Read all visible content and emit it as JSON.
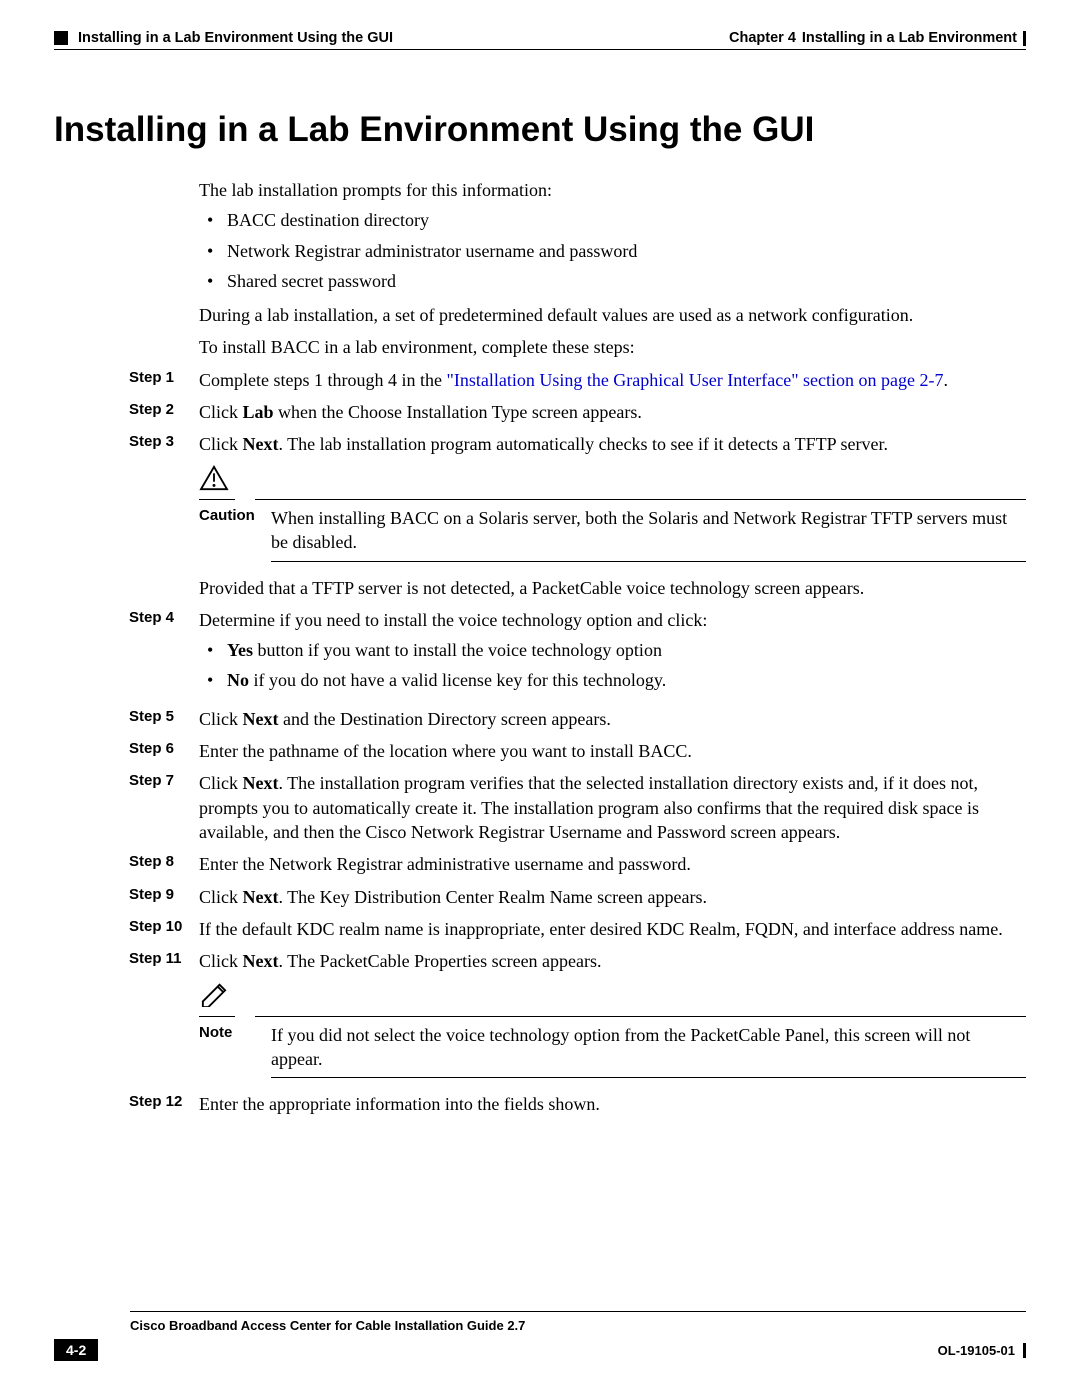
{
  "header": {
    "left": "Installing in a Lab Environment Using the GUI",
    "right_prefix": "Chapter 4",
    "right_title": "Installing in a Lab Environment"
  },
  "title": "Installing in a Lab Environment Using the GUI",
  "intro": "The lab installation prompts for this information:",
  "intro_bullets": [
    "BACC destination directory",
    "Network Registrar administrator username and password",
    "Shared secret password"
  ],
  "para1": "During a lab installation, a set of predetermined default values are used as a network configuration.",
  "para2": "To install BACC in a lab environment, complete these steps:",
  "steps": {
    "s1": {
      "label": "Step 1",
      "prefix": "Complete steps 1 through 4 in the ",
      "link": "\"Installation Using the Graphical User Interface\" section on page 2-7",
      "suffix": "."
    },
    "s2": {
      "label": "Step 2",
      "a": "Click ",
      "b": "Lab",
      "c": " when the Choose Installation Type screen appears."
    },
    "s3": {
      "label": "Step 3",
      "a": "Click ",
      "b": "Next",
      "c": ". The lab installation program automatically checks to see if it detects a TFTP server."
    },
    "caution": {
      "label": "Caution",
      "text": "When installing BACC on a Solaris server, both the Solaris and Network Registrar TFTP servers must be disabled."
    },
    "after_caution": "Provided that a TFTP server is not detected, a PacketCable voice technology screen appears.",
    "s4": {
      "label": "Step 4",
      "text": "Determine if you need to install the voice technology option and click:",
      "b1a": "Yes",
      "b1b": " button if you want to install the voice technology option",
      "b2a": "No",
      "b2b": " if you do not have a valid license key for this technology."
    },
    "s5": {
      "label": "Step 5",
      "a": "Click ",
      "b": "Next",
      "c": " and the Destination Directory screen appears."
    },
    "s6": {
      "label": "Step 6",
      "text": "Enter the pathname of the location where you want to install BACC."
    },
    "s7": {
      "label": "Step 7",
      "a": "Click ",
      "b": "Next",
      "c": ". The installation program verifies that the selected installation directory exists and, if it does not, prompts you to automatically create it. The installation program also confirms that the required disk space is available, and then the Cisco Network Registrar Username and Password screen appears."
    },
    "s8": {
      "label": "Step 8",
      "text": "Enter the Network Registrar administrative username and password."
    },
    "s9": {
      "label": "Step 9",
      "a": "Click ",
      "b": "Next",
      "c": ". The Key Distribution Center Realm Name screen appears."
    },
    "s10": {
      "label": "Step 10",
      "text": "If the default KDC realm name is inappropriate, enter desired KDC Realm, FQDN, and interface address name."
    },
    "s11": {
      "label": "Step 11",
      "a": "Click ",
      "b": "Next",
      "c": ". The PacketCable Properties screen appears."
    },
    "note": {
      "label": "Note",
      "text": "If you did not select the voice technology option from the PacketCable Panel, this screen will not appear."
    },
    "s12": {
      "label": "Step 12",
      "text": "Enter the appropriate information into the fields shown."
    }
  },
  "footer": {
    "guide": "Cisco Broadband Access Center for Cable Installation Guide 2.7",
    "page": "4-2",
    "doc": "OL-19105-01"
  }
}
